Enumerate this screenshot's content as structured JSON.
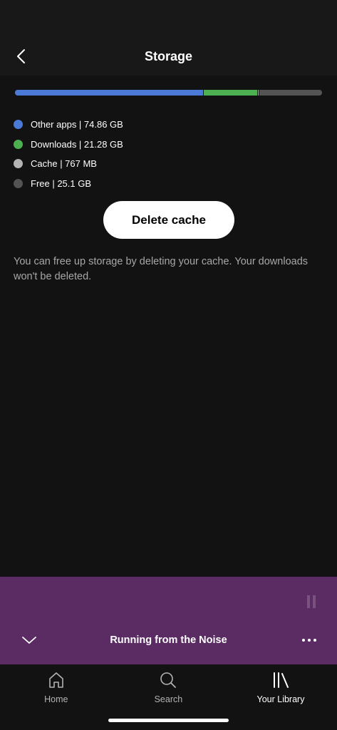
{
  "header": {
    "title": "Storage",
    "back_icon": "chevron-left-icon"
  },
  "storage": {
    "segments": [
      {
        "key": "other_apps",
        "color": "#4a7ad6",
        "value_gb": 74.86
      },
      {
        "key": "downloads",
        "color": "#4caf50",
        "value_gb": 21.28
      },
      {
        "key": "cache",
        "color": "#b3b3b3",
        "value_gb": 0.767
      },
      {
        "key": "free",
        "color": "#535353",
        "value_gb": 25.1
      }
    ]
  },
  "legend": [
    {
      "label": "Other apps | 74.86 GB",
      "color": "#4a7ad6"
    },
    {
      "label": "Downloads | 21.28 GB",
      "color": "#4caf50"
    },
    {
      "label": "Cache | 767 MB",
      "color": "#b3b3b3"
    },
    {
      "label": "Free | 25.1 GB",
      "color": "#535353"
    }
  ],
  "actions": {
    "delete_cache_label": "Delete cache"
  },
  "helper_text": "You can free up storage by deleting your cache. Your downloads won't be deleted.",
  "player": {
    "track_title": "Running from the Noise",
    "background": "#5b2c63",
    "collapse_icon": "chevron-down-icon",
    "more_icon": "more-horizontal-icon"
  },
  "tabs": [
    {
      "label": "Home",
      "icon": "home-icon",
      "active": false
    },
    {
      "label": "Search",
      "icon": "search-icon",
      "active": false
    },
    {
      "label": "Your Library",
      "icon": "library-icon",
      "active": true
    }
  ]
}
